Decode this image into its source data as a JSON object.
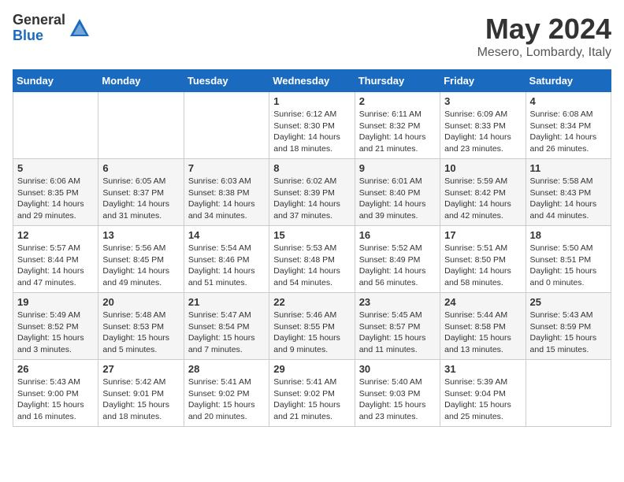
{
  "header": {
    "logo_general": "General",
    "logo_blue": "Blue",
    "month_year": "May 2024",
    "location": "Mesero, Lombardy, Italy"
  },
  "days_of_week": [
    "Sunday",
    "Monday",
    "Tuesday",
    "Wednesday",
    "Thursday",
    "Friday",
    "Saturday"
  ],
  "weeks": [
    [
      {
        "day": "",
        "info": ""
      },
      {
        "day": "",
        "info": ""
      },
      {
        "day": "",
        "info": ""
      },
      {
        "day": "1",
        "info": "Sunrise: 6:12 AM\nSunset: 8:30 PM\nDaylight: 14 hours\nand 18 minutes."
      },
      {
        "day": "2",
        "info": "Sunrise: 6:11 AM\nSunset: 8:32 PM\nDaylight: 14 hours\nand 21 minutes."
      },
      {
        "day": "3",
        "info": "Sunrise: 6:09 AM\nSunset: 8:33 PM\nDaylight: 14 hours\nand 23 minutes."
      },
      {
        "day": "4",
        "info": "Sunrise: 6:08 AM\nSunset: 8:34 PM\nDaylight: 14 hours\nand 26 minutes."
      }
    ],
    [
      {
        "day": "5",
        "info": "Sunrise: 6:06 AM\nSunset: 8:35 PM\nDaylight: 14 hours\nand 29 minutes."
      },
      {
        "day": "6",
        "info": "Sunrise: 6:05 AM\nSunset: 8:37 PM\nDaylight: 14 hours\nand 31 minutes."
      },
      {
        "day": "7",
        "info": "Sunrise: 6:03 AM\nSunset: 8:38 PM\nDaylight: 14 hours\nand 34 minutes."
      },
      {
        "day": "8",
        "info": "Sunrise: 6:02 AM\nSunset: 8:39 PM\nDaylight: 14 hours\nand 37 minutes."
      },
      {
        "day": "9",
        "info": "Sunrise: 6:01 AM\nSunset: 8:40 PM\nDaylight: 14 hours\nand 39 minutes."
      },
      {
        "day": "10",
        "info": "Sunrise: 5:59 AM\nSunset: 8:42 PM\nDaylight: 14 hours\nand 42 minutes."
      },
      {
        "day": "11",
        "info": "Sunrise: 5:58 AM\nSunset: 8:43 PM\nDaylight: 14 hours\nand 44 minutes."
      }
    ],
    [
      {
        "day": "12",
        "info": "Sunrise: 5:57 AM\nSunset: 8:44 PM\nDaylight: 14 hours\nand 47 minutes."
      },
      {
        "day": "13",
        "info": "Sunrise: 5:56 AM\nSunset: 8:45 PM\nDaylight: 14 hours\nand 49 minutes."
      },
      {
        "day": "14",
        "info": "Sunrise: 5:54 AM\nSunset: 8:46 PM\nDaylight: 14 hours\nand 51 minutes."
      },
      {
        "day": "15",
        "info": "Sunrise: 5:53 AM\nSunset: 8:48 PM\nDaylight: 14 hours\nand 54 minutes."
      },
      {
        "day": "16",
        "info": "Sunrise: 5:52 AM\nSunset: 8:49 PM\nDaylight: 14 hours\nand 56 minutes."
      },
      {
        "day": "17",
        "info": "Sunrise: 5:51 AM\nSunset: 8:50 PM\nDaylight: 14 hours\nand 58 minutes."
      },
      {
        "day": "18",
        "info": "Sunrise: 5:50 AM\nSunset: 8:51 PM\nDaylight: 15 hours\nand 0 minutes."
      }
    ],
    [
      {
        "day": "19",
        "info": "Sunrise: 5:49 AM\nSunset: 8:52 PM\nDaylight: 15 hours\nand 3 minutes."
      },
      {
        "day": "20",
        "info": "Sunrise: 5:48 AM\nSunset: 8:53 PM\nDaylight: 15 hours\nand 5 minutes."
      },
      {
        "day": "21",
        "info": "Sunrise: 5:47 AM\nSunset: 8:54 PM\nDaylight: 15 hours\nand 7 minutes."
      },
      {
        "day": "22",
        "info": "Sunrise: 5:46 AM\nSunset: 8:55 PM\nDaylight: 15 hours\nand 9 minutes."
      },
      {
        "day": "23",
        "info": "Sunrise: 5:45 AM\nSunset: 8:57 PM\nDaylight: 15 hours\nand 11 minutes."
      },
      {
        "day": "24",
        "info": "Sunrise: 5:44 AM\nSunset: 8:58 PM\nDaylight: 15 hours\nand 13 minutes."
      },
      {
        "day": "25",
        "info": "Sunrise: 5:43 AM\nSunset: 8:59 PM\nDaylight: 15 hours\nand 15 minutes."
      }
    ],
    [
      {
        "day": "26",
        "info": "Sunrise: 5:43 AM\nSunset: 9:00 PM\nDaylight: 15 hours\nand 16 minutes."
      },
      {
        "day": "27",
        "info": "Sunrise: 5:42 AM\nSunset: 9:01 PM\nDaylight: 15 hours\nand 18 minutes."
      },
      {
        "day": "28",
        "info": "Sunrise: 5:41 AM\nSunset: 9:02 PM\nDaylight: 15 hours\nand 20 minutes."
      },
      {
        "day": "29",
        "info": "Sunrise: 5:41 AM\nSunset: 9:02 PM\nDaylight: 15 hours\nand 21 minutes."
      },
      {
        "day": "30",
        "info": "Sunrise: 5:40 AM\nSunset: 9:03 PM\nDaylight: 15 hours\nand 23 minutes."
      },
      {
        "day": "31",
        "info": "Sunrise: 5:39 AM\nSunset: 9:04 PM\nDaylight: 15 hours\nand 25 minutes."
      },
      {
        "day": "",
        "info": ""
      }
    ]
  ]
}
